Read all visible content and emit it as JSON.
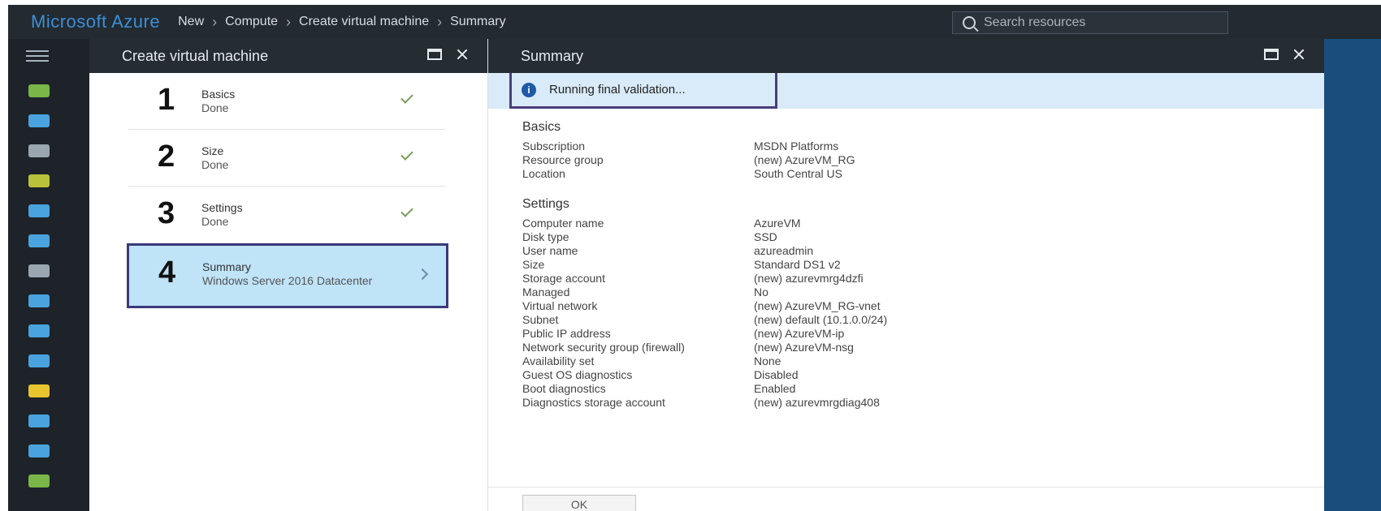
{
  "brand": "Microsoft Azure",
  "breadcrumb": [
    "New",
    "Compute",
    "Create virtual machine",
    "Summary"
  ],
  "search": {
    "placeholder": "Search resources"
  },
  "colors": {
    "accent": "#3a8fd8",
    "active_step": "#bfe3f7",
    "info": "#1f5aa6"
  },
  "rail_icons": [
    {
      "name": "plus-icon",
      "color": "#7ab648"
    },
    {
      "name": "dashboard-icon",
      "color": "#4aa3df"
    },
    {
      "name": "resource-groups-icon",
      "color": "#9aa7b1"
    },
    {
      "name": "all-resources-icon",
      "color": "#b8c23a"
    },
    {
      "name": "app-services-icon",
      "color": "#4aa3df"
    },
    {
      "name": "sql-icon",
      "color": "#4aa3df"
    },
    {
      "name": "storage-icon",
      "color": "#9aa7b1"
    },
    {
      "name": "virtual-machines-icon",
      "color": "#4aa3df"
    },
    {
      "name": "cloud-services-icon",
      "color": "#4aa3df"
    },
    {
      "name": "cloud-icon",
      "color": "#4aa3df"
    },
    {
      "name": "key-icon",
      "color": "#e8c42e"
    },
    {
      "name": "network-icon",
      "color": "#4aa3df"
    },
    {
      "name": "monitor-icon",
      "color": "#4aa3df"
    },
    {
      "name": "marketplace-icon",
      "color": "#7ab648"
    }
  ],
  "create_blade": {
    "title": "Create virtual machine",
    "steps": [
      {
        "num": "1",
        "title": "Basics",
        "sub": "Done"
      },
      {
        "num": "2",
        "title": "Size",
        "sub": "Done"
      },
      {
        "num": "3",
        "title": "Settings",
        "sub": "Done"
      },
      {
        "num": "4",
        "title": "Summary",
        "sub": "Windows Server 2016 Datacenter"
      }
    ]
  },
  "summary_blade": {
    "title": "Summary",
    "validation": "Running final validation...",
    "basics_title": "Basics",
    "basics": [
      {
        "k": "Subscription",
        "v": "MSDN Platforms"
      },
      {
        "k": "Resource group",
        "v": "(new) AzureVM_RG"
      },
      {
        "k": "Location",
        "v": "South Central US"
      }
    ],
    "settings_title": "Settings",
    "settings": [
      {
        "k": "Computer name",
        "v": "AzureVM"
      },
      {
        "k": "Disk type",
        "v": "SSD"
      },
      {
        "k": "User name",
        "v": "azureadmin"
      },
      {
        "k": "Size",
        "v": "Standard DS1 v2"
      },
      {
        "k": "Storage account",
        "v": "(new) azurevmrg4dzfi"
      },
      {
        "k": "Managed",
        "v": "No"
      },
      {
        "k": "Virtual network",
        "v": "(new) AzureVM_RG-vnet"
      },
      {
        "k": "Subnet",
        "v": "(new) default (10.1.0.0/24)"
      },
      {
        "k": "Public IP address",
        "v": "(new) AzureVM-ip"
      },
      {
        "k": "Network security group (firewall)",
        "v": "(new) AzureVM-nsg"
      },
      {
        "k": "Availability set",
        "v": "None"
      },
      {
        "k": "Guest OS diagnostics",
        "v": "Disabled"
      },
      {
        "k": "Boot diagnostics",
        "v": "Enabled"
      },
      {
        "k": "Diagnostics storage account",
        "v": "(new) azurevmrgdiag408"
      }
    ],
    "ok_label": "OK"
  }
}
